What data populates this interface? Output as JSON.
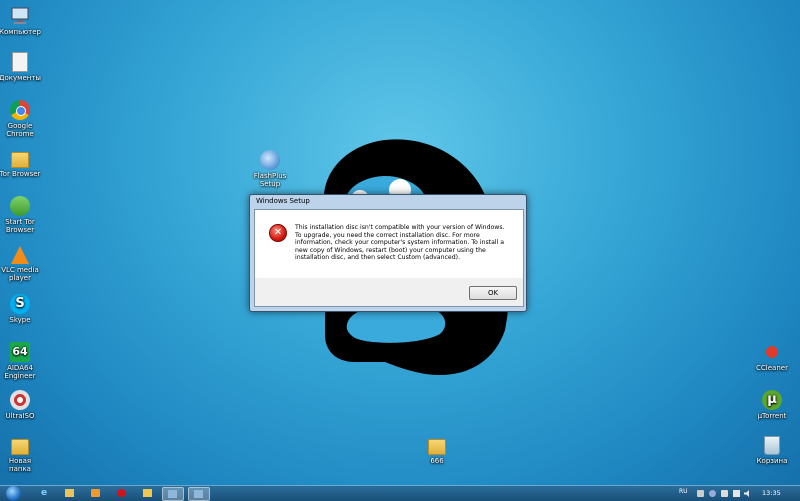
{
  "desktop_left": [
    {
      "label": "Компьютер",
      "icon": "computer-icon"
    },
    {
      "label": "Документы",
      "icon": "documents-icon"
    },
    {
      "label": "Google Chrome",
      "icon": "chrome-icon"
    },
    {
      "label": "Tor Browser",
      "icon": "folder-icon"
    },
    {
      "label": "Start Tor Browser",
      "icon": "tor-icon"
    },
    {
      "label": "VLC media player",
      "icon": "vlc-icon"
    },
    {
      "label": "Skype",
      "icon": "skype-icon"
    },
    {
      "label": "AIDA64 Engineer",
      "icon": "aida64-icon"
    },
    {
      "label": "UltraISO",
      "icon": "ultraiso-icon"
    },
    {
      "label": "Новая папка",
      "icon": "folder-icon"
    }
  ],
  "desktop_mid": [
    {
      "label": "FlashPlus Setup",
      "icon": "flash-icon"
    },
    {
      "label": "666",
      "icon": "folder-icon"
    }
  ],
  "desktop_right": [
    {
      "label": "CCleaner",
      "icon": "ccleaner-icon"
    },
    {
      "label": "µTorrent",
      "icon": "utorrent-icon"
    },
    {
      "label": "Корзина",
      "icon": "recycle-bin-icon"
    }
  ],
  "dialog": {
    "title": "Windows Setup",
    "message": "This installation disc isn't compatible with your version of Windows. To upgrade, you need the correct installation disc. For more information, check your computer's system information. To install a new copy of Windows, restart (boot) your computer using the installation disc, and then select Custom (advanced).",
    "ok_label": "OK"
  },
  "taskbar": {
    "pinned": [
      "ie-icon",
      "explorer-icon",
      "media-player-icon",
      "opera-icon",
      "windows-explorer-icon",
      "setup-icon",
      "setup-icon"
    ],
    "language": "RU",
    "time": "13:35"
  },
  "colors": {
    "desktop": "#2b97cf",
    "taskbar": "#1f5b86",
    "error_red": "#d11a0f"
  }
}
